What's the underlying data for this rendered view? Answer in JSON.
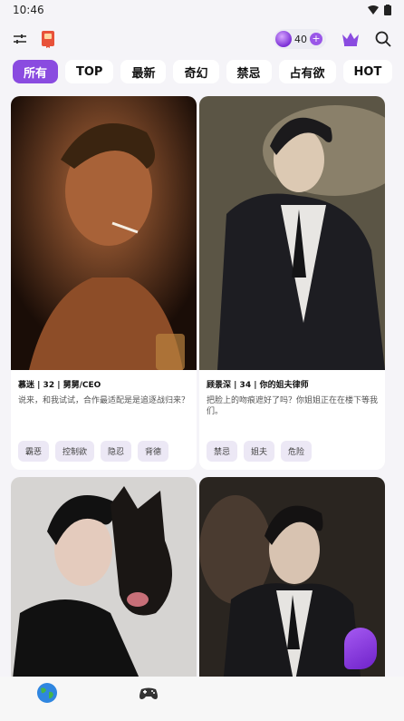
{
  "status_bar": {
    "time": "10:46"
  },
  "header": {
    "gems": "40"
  },
  "tabs": [
    {
      "label": "所有",
      "active": true
    },
    {
      "label": "TOP"
    },
    {
      "label": "最新"
    },
    {
      "label": "奇幻"
    },
    {
      "label": "禁忌"
    },
    {
      "label": "占有欲"
    },
    {
      "label": "HOT"
    }
  ],
  "cards": [
    {
      "name": "慕迷 | 32 | 舅舅/CEO",
      "desc": "说来，和我试试，合作最适配是是追逐战归来？",
      "tags": [
        "霸恶",
        "控制欲",
        "隐忍",
        "背德"
      ]
    },
    {
      "name": "顾景深 | 34 | 你的姐夫律师",
      "desc": "把脸上的吻痕遮好了吗？你姐姐正在在楼下等我们。",
      "tags": [
        "禁忌",
        "姐夫",
        "危险"
      ]
    }
  ],
  "colors": {
    "accent": "#8a4be0",
    "tag_bg": "#ece8f5"
  },
  "icons": [
    "wifi-icon",
    "battery-icon",
    "filter-icon",
    "book-icon",
    "gem-icon",
    "plus-icon",
    "crown-icon",
    "search-icon",
    "globe-icon",
    "gamepad-icon"
  ]
}
